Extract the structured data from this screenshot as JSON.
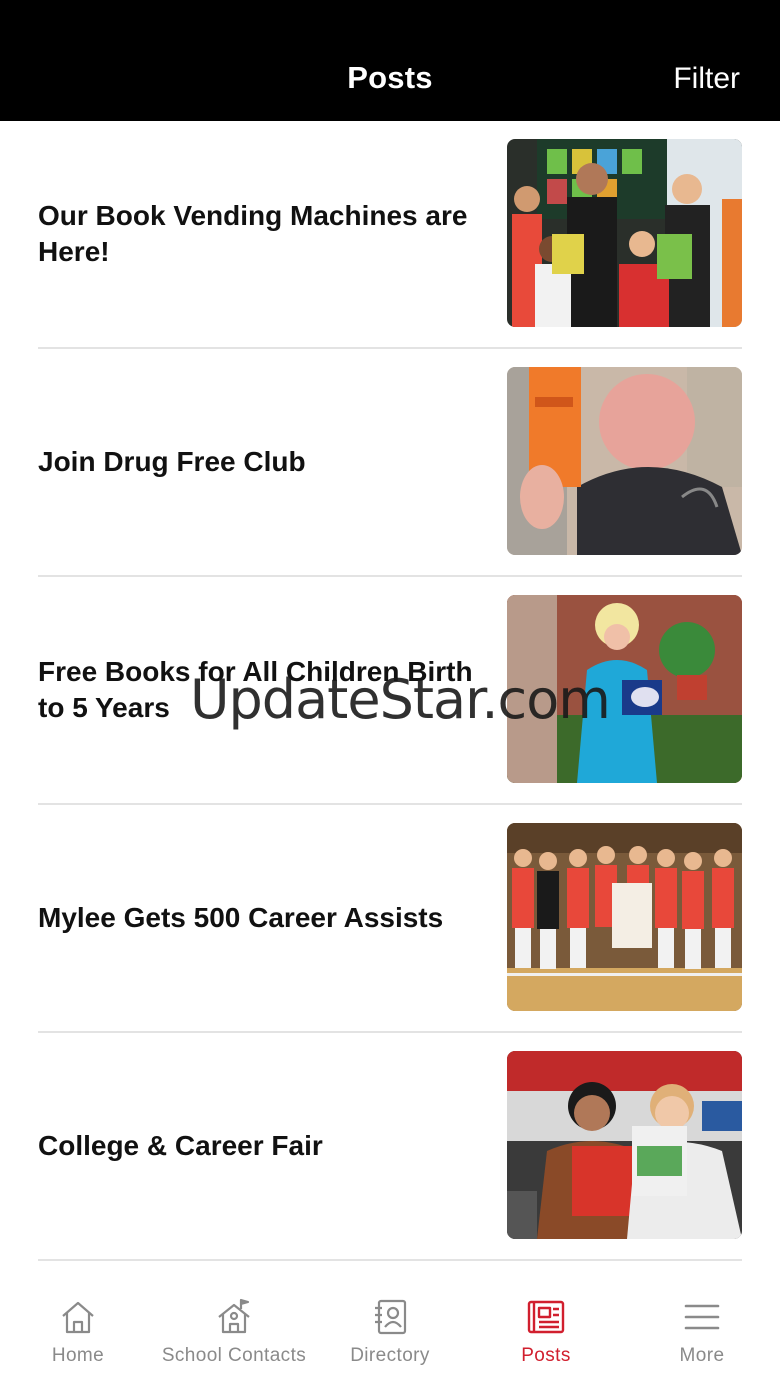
{
  "header": {
    "title": "Posts",
    "filter_label": "Filter"
  },
  "posts": [
    {
      "title": "Our Book Vending Machines are Here!",
      "image": "students-with-books-photo"
    },
    {
      "title": "Join Drug Free Club",
      "image": "student-with-flyer-photo"
    },
    {
      "title": "Free Books for All Children Birth to 5 Years",
      "image": "woman-in-blue-suit-photo"
    },
    {
      "title": "Mylee Gets 500 Career Assists",
      "image": "volleyball-team-photo"
    },
    {
      "title": "College & Career Fair",
      "image": "students-at-fair-photo"
    }
  ],
  "watermark": "UpdateStar.com",
  "tabs": [
    {
      "label": "Home",
      "icon": "home-icon"
    },
    {
      "label": "School Contacts",
      "icon": "school-icon"
    },
    {
      "label": "Directory",
      "icon": "directory-icon"
    },
    {
      "label": "Posts",
      "icon": "posts-icon"
    },
    {
      "label": "More",
      "icon": "menu-icon"
    }
  ],
  "colors": {
    "header_bg": "#000000",
    "accent": "#d11f2e",
    "inactive": "#8a8a8a"
  }
}
